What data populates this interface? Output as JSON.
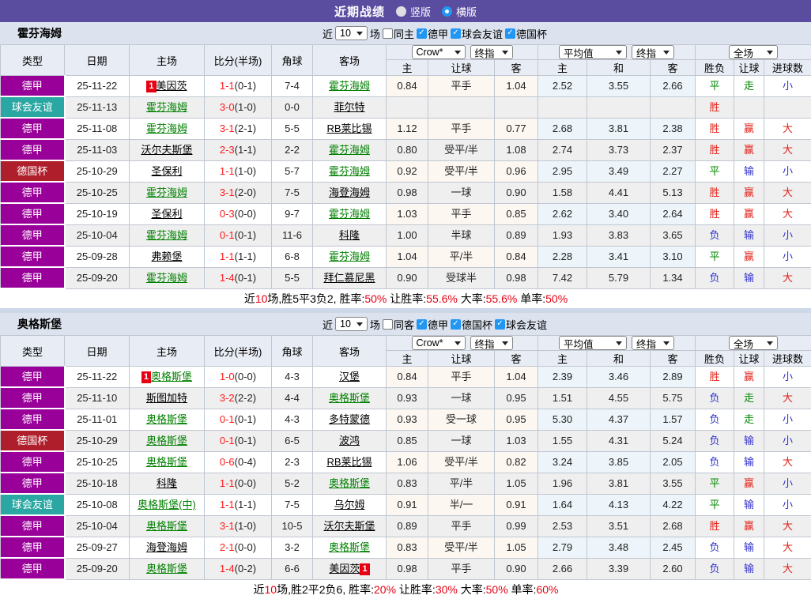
{
  "topbar": {
    "title": "近期战绩",
    "radios": [
      {
        "label": "竖版",
        "selected": false
      },
      {
        "label": "横版",
        "selected": true
      }
    ]
  },
  "ui": {
    "recent": "近",
    "games_suffix": "场"
  },
  "table_header": {
    "left_cols": [
      "类型",
      "日期",
      "主场",
      "比分(半场)",
      "角球",
      "客场"
    ],
    "odds_group": {
      "company_select": "Crow*",
      "index_select": "终指",
      "cols": [
        "主",
        "让球",
        "客"
      ]
    },
    "avg_group": {
      "company_select": "平均值",
      "index_select": "终指",
      "cols": [
        "主",
        "和",
        "客"
      ]
    },
    "result_group": {
      "scope_select": "全场",
      "cols": [
        "胜负",
        "让球",
        "进球数"
      ]
    }
  },
  "colors": {
    "topbar": "#5a4da0",
    "league": {
      "德甲": "#990099",
      "球会友谊": "#2aa7a3",
      "德国杯": "#af1f2b"
    },
    "result": {
      "red": "#e2231a",
      "green": "#008800",
      "blue": "#3333cc"
    },
    "score_fulltime": "#ff1a1a",
    "team_focal": "#008000",
    "summary_red": "#e60012"
  },
  "sections": [
    {
      "team": "霍芬海姆",
      "filters": {
        "games": "10",
        "same_label": "同主",
        "same_checked": false,
        "leagues": [
          {
            "label": "德甲",
            "checked": true
          },
          {
            "label": "球会友谊",
            "checked": true
          },
          {
            "label": "德国杯",
            "checked": true
          }
        ]
      },
      "rows": [
        {
          "type": "德甲",
          "date": "25-11-22",
          "home": {
            "name": "美因茨",
            "badge": "1",
            "badge_side": "left"
          },
          "ft": "1-1",
          "ht": "(0-1)",
          "corners": "7-4",
          "away": {
            "name": "霍芬海姆",
            "focal": true
          },
          "odds": [
            "0.84",
            "平手",
            "1.04"
          ],
          "avg": [
            "2.52",
            "3.55",
            "2.66"
          ],
          "res": [
            [
              "平",
              "green"
            ],
            [
              "走",
              "green"
            ],
            [
              "小",
              "blue"
            ]
          ]
        },
        {
          "type": "球会友谊",
          "date": "25-11-13",
          "home": {
            "name": "霍芬海姆",
            "focal": true
          },
          "ft": "3-0",
          "ht": "(1-0)",
          "corners": "0-0",
          "away": {
            "name": "菲尔特"
          },
          "odds": [
            "",
            "",
            ""
          ],
          "avg": [
            "",
            "",
            ""
          ],
          "res": [
            [
              "胜",
              "red"
            ],
            [
              "",
              ""
            ],
            [
              "",
              ""
            ]
          ]
        },
        {
          "type": "德甲",
          "date": "25-11-08",
          "home": {
            "name": "霍芬海姆",
            "focal": true
          },
          "ft": "3-1",
          "ht": "(2-1)",
          "corners": "5-5",
          "away": {
            "name": "RB莱比锡"
          },
          "odds": [
            "1.12",
            "平手",
            "0.77"
          ],
          "avg": [
            "2.68",
            "3.81",
            "2.38"
          ],
          "res": [
            [
              "胜",
              "red"
            ],
            [
              "赢",
              "red"
            ],
            [
              "大",
              "red"
            ]
          ]
        },
        {
          "type": "德甲",
          "date": "25-11-03",
          "home": {
            "name": "沃尔夫斯堡"
          },
          "ft": "2-3",
          "ht": "(1-1)",
          "corners": "2-2",
          "away": {
            "name": "霍芬海姆",
            "focal": true
          },
          "odds": [
            "0.80",
            "受平/半",
            "1.08"
          ],
          "avg": [
            "2.74",
            "3.73",
            "2.37"
          ],
          "res": [
            [
              "胜",
              "red"
            ],
            [
              "赢",
              "red"
            ],
            [
              "大",
              "red"
            ]
          ]
        },
        {
          "type": "德国杯",
          "date": "25-10-29",
          "home": {
            "name": "圣保利"
          },
          "ft": "1-1",
          "ht": "(1-0)",
          "corners": "5-7",
          "away": {
            "name": "霍芬海姆",
            "focal": true
          },
          "odds": [
            "0.92",
            "受平/半",
            "0.96"
          ],
          "avg": [
            "2.95",
            "3.49",
            "2.27"
          ],
          "res": [
            [
              "平",
              "green"
            ],
            [
              "输",
              "blue"
            ],
            [
              "小",
              "blue"
            ]
          ]
        },
        {
          "type": "德甲",
          "date": "25-10-25",
          "home": {
            "name": "霍芬海姆",
            "focal": true
          },
          "ft": "3-1",
          "ht": "(2-0)",
          "corners": "7-5",
          "away": {
            "name": "海登海姆"
          },
          "odds": [
            "0.98",
            "一球",
            "0.90"
          ],
          "avg": [
            "1.58",
            "4.41",
            "5.13"
          ],
          "res": [
            [
              "胜",
              "red"
            ],
            [
              "赢",
              "red"
            ],
            [
              "大",
              "red"
            ]
          ]
        },
        {
          "type": "德甲",
          "date": "25-10-19",
          "home": {
            "name": "圣保利"
          },
          "ft": "0-3",
          "ht": "(0-0)",
          "corners": "9-7",
          "away": {
            "name": "霍芬海姆",
            "focal": true
          },
          "odds": [
            "1.03",
            "平手",
            "0.85"
          ],
          "avg": [
            "2.62",
            "3.40",
            "2.64"
          ],
          "res": [
            [
              "胜",
              "red"
            ],
            [
              "赢",
              "red"
            ],
            [
              "大",
              "red"
            ]
          ]
        },
        {
          "type": "德甲",
          "date": "25-10-04",
          "home": {
            "name": "霍芬海姆",
            "focal": true
          },
          "ft": "0-1",
          "ht": "(0-1)",
          "corners": "11-6",
          "away": {
            "name": "科隆"
          },
          "odds": [
            "1.00",
            "半球",
            "0.89"
          ],
          "avg": [
            "1.93",
            "3.83",
            "3.65"
          ],
          "res": [
            [
              "负",
              "blue"
            ],
            [
              "输",
              "blue"
            ],
            [
              "小",
              "blue"
            ]
          ]
        },
        {
          "type": "德甲",
          "date": "25-09-28",
          "home": {
            "name": "弗赖堡"
          },
          "ft": "1-1",
          "ht": "(1-1)",
          "corners": "6-8",
          "away": {
            "name": "霍芬海姆",
            "focal": true
          },
          "odds": [
            "1.04",
            "平/半",
            "0.84"
          ],
          "avg": [
            "2.28",
            "3.41",
            "3.10"
          ],
          "res": [
            [
              "平",
              "green"
            ],
            [
              "赢",
              "red"
            ],
            [
              "小",
              "blue"
            ]
          ]
        },
        {
          "type": "德甲",
          "date": "25-09-20",
          "home": {
            "name": "霍芬海姆",
            "focal": true
          },
          "ft": "1-4",
          "ht": "(0-1)",
          "corners": "5-5",
          "away": {
            "name": "拜仁慕尼黑"
          },
          "odds": [
            "0.90",
            "受球半",
            "0.98"
          ],
          "avg": [
            "7.42",
            "5.79",
            "1.34"
          ],
          "res": [
            [
              "负",
              "blue"
            ],
            [
              "输",
              "blue"
            ],
            [
              "大",
              "red"
            ]
          ]
        }
      ],
      "summary": [
        {
          "text": "近"
        },
        {
          "text": "10",
          "red": true
        },
        {
          "text": "场,胜5平3负2, 胜率:"
        },
        {
          "text": "50%",
          "red": true
        },
        {
          "text": " 让胜率:"
        },
        {
          "text": "55.6%",
          "red": true
        },
        {
          "text": " 大率:"
        },
        {
          "text": "55.6%",
          "red": true
        },
        {
          "text": " 单率:"
        },
        {
          "text": "50%",
          "red": true
        }
      ]
    },
    {
      "team": "奥格斯堡",
      "filters": {
        "games": "10",
        "same_label": "同客",
        "same_checked": false,
        "leagues": [
          {
            "label": "德甲",
            "checked": true
          },
          {
            "label": "德国杯",
            "checked": true
          },
          {
            "label": "球会友谊",
            "checked": true
          }
        ]
      },
      "rows": [
        {
          "type": "德甲",
          "date": "25-11-22",
          "home": {
            "name": "奥格斯堡",
            "focal": true,
            "badge": "1",
            "badge_side": "left"
          },
          "ft": "1-0",
          "ht": "(0-0)",
          "corners": "4-3",
          "away": {
            "name": "汉堡"
          },
          "odds": [
            "0.84",
            "平手",
            "1.04"
          ],
          "avg": [
            "2.39",
            "3.46",
            "2.89"
          ],
          "res": [
            [
              "胜",
              "red"
            ],
            [
              "赢",
              "red"
            ],
            [
              "小",
              "blue"
            ]
          ]
        },
        {
          "type": "德甲",
          "date": "25-11-10",
          "home": {
            "name": "斯图加特"
          },
          "ft": "3-2",
          "ht": "(2-2)",
          "corners": "4-4",
          "away": {
            "name": "奥格斯堡",
            "focal": true
          },
          "odds": [
            "0.93",
            "一球",
            "0.95"
          ],
          "avg": [
            "1.51",
            "4.55",
            "5.75"
          ],
          "res": [
            [
              "负",
              "blue"
            ],
            [
              "走",
              "green"
            ],
            [
              "大",
              "red"
            ]
          ]
        },
        {
          "type": "德甲",
          "date": "25-11-01",
          "home": {
            "name": "奥格斯堡",
            "focal": true
          },
          "ft": "0-1",
          "ht": "(0-1)",
          "corners": "4-3",
          "away": {
            "name": "多特蒙德"
          },
          "odds": [
            "0.93",
            "受一球",
            "0.95"
          ],
          "avg": [
            "5.30",
            "4.37",
            "1.57"
          ],
          "res": [
            [
              "负",
              "blue"
            ],
            [
              "走",
              "green"
            ],
            [
              "小",
              "blue"
            ]
          ]
        },
        {
          "type": "德国杯",
          "date": "25-10-29",
          "home": {
            "name": "奥格斯堡",
            "focal": true
          },
          "ft": "0-1",
          "ht": "(0-1)",
          "corners": "6-5",
          "away": {
            "name": "波鸿"
          },
          "odds": [
            "0.85",
            "一球",
            "1.03"
          ],
          "avg": [
            "1.55",
            "4.31",
            "5.24"
          ],
          "res": [
            [
              "负",
              "blue"
            ],
            [
              "输",
              "blue"
            ],
            [
              "小",
              "blue"
            ]
          ]
        },
        {
          "type": "德甲",
          "date": "25-10-25",
          "home": {
            "name": "奥格斯堡",
            "focal": true
          },
          "ft": "0-6",
          "ht": "(0-4)",
          "corners": "2-3",
          "away": {
            "name": "RB莱比锡"
          },
          "odds": [
            "1.06",
            "受平/半",
            "0.82"
          ],
          "avg": [
            "3.24",
            "3.85",
            "2.05"
          ],
          "res": [
            [
              "负",
              "blue"
            ],
            [
              "输",
              "blue"
            ],
            [
              "大",
              "red"
            ]
          ]
        },
        {
          "type": "德甲",
          "date": "25-10-18",
          "home": {
            "name": "科隆"
          },
          "ft": "1-1",
          "ht": "(0-0)",
          "corners": "5-2",
          "away": {
            "name": "奥格斯堡",
            "focal": true
          },
          "odds": [
            "0.83",
            "平/半",
            "1.05"
          ],
          "avg": [
            "1.96",
            "3.81",
            "3.55"
          ],
          "res": [
            [
              "平",
              "green"
            ],
            [
              "赢",
              "red"
            ],
            [
              "小",
              "blue"
            ]
          ]
        },
        {
          "type": "球会友谊",
          "date": "25-10-08",
          "home": {
            "name": "奥格斯堡(中)",
            "focal": true
          },
          "ft": "1-1",
          "ht": "(1-1)",
          "corners": "7-5",
          "away": {
            "name": "乌尔姆"
          },
          "odds": [
            "0.91",
            "半/一",
            "0.91"
          ],
          "avg": [
            "1.64",
            "4.13",
            "4.22"
          ],
          "res": [
            [
              "平",
              "green"
            ],
            [
              "输",
              "blue"
            ],
            [
              "小",
              "blue"
            ]
          ]
        },
        {
          "type": "德甲",
          "date": "25-10-04",
          "home": {
            "name": "奥格斯堡",
            "focal": true
          },
          "ft": "3-1",
          "ht": "(1-0)",
          "corners": "10-5",
          "away": {
            "name": "沃尔夫斯堡"
          },
          "odds": [
            "0.89",
            "平手",
            "0.99"
          ],
          "avg": [
            "2.53",
            "3.51",
            "2.68"
          ],
          "res": [
            [
              "胜",
              "red"
            ],
            [
              "赢",
              "red"
            ],
            [
              "大",
              "red"
            ]
          ]
        },
        {
          "type": "德甲",
          "date": "25-09-27",
          "home": {
            "name": "海登海姆"
          },
          "ft": "2-1",
          "ht": "(0-0)",
          "corners": "3-2",
          "away": {
            "name": "奥格斯堡",
            "focal": true
          },
          "odds": [
            "0.83",
            "受平/半",
            "1.05"
          ],
          "avg": [
            "2.79",
            "3.48",
            "2.45"
          ],
          "res": [
            [
              "负",
              "blue"
            ],
            [
              "输",
              "blue"
            ],
            [
              "大",
              "red"
            ]
          ]
        },
        {
          "type": "德甲",
          "date": "25-09-20",
          "home": {
            "name": "奥格斯堡",
            "focal": true
          },
          "ft": "1-4",
          "ht": "(0-2)",
          "corners": "6-6",
          "away": {
            "name": "美因茨",
            "badge": "1",
            "badge_side": "right"
          },
          "odds": [
            "0.98",
            "平手",
            "0.90"
          ],
          "avg": [
            "2.66",
            "3.39",
            "2.60"
          ],
          "res": [
            [
              "负",
              "blue"
            ],
            [
              "输",
              "blue"
            ],
            [
              "大",
              "red"
            ]
          ]
        }
      ],
      "summary": [
        {
          "text": "近"
        },
        {
          "text": "10",
          "red": true
        },
        {
          "text": "场,胜2平2负6, 胜率:"
        },
        {
          "text": "20%",
          "red": true
        },
        {
          "text": " 让胜率:"
        },
        {
          "text": "30%",
          "red": true
        },
        {
          "text": " 大率:"
        },
        {
          "text": "50%",
          "red": true
        },
        {
          "text": " 单率:"
        },
        {
          "text": "60%",
          "red": true
        }
      ]
    }
  ]
}
